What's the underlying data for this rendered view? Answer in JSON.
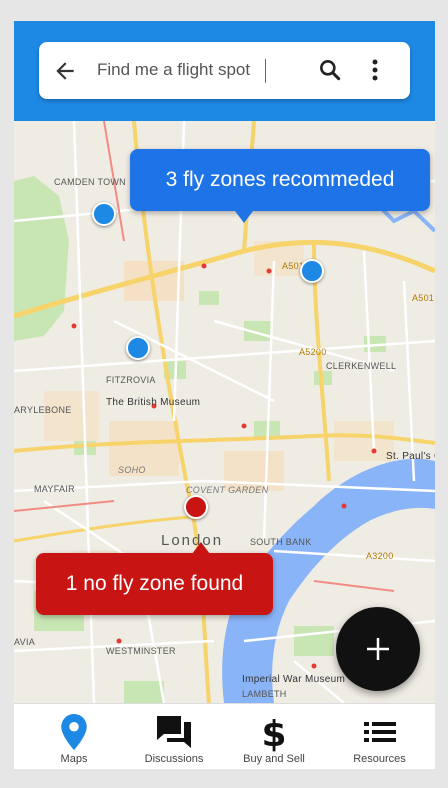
{
  "search": {
    "text": "Find me a flight spot"
  },
  "map": {
    "labels": {
      "camden_town": "CAMDEN TOWN",
      "fitzrovia": "FITZROVIA",
      "marylebone": "ARYLEBONE",
      "british_museum": "The British Museum",
      "clerkenwell": "CLERKENWELL",
      "soho": "SOHO",
      "covent_garden": "COVENT GARDEN",
      "mayfair": "MAYFAIR",
      "st_pauls": "St. Paul's Ca",
      "london": "London",
      "south_bank": "SOUTH BANK",
      "westminster": "WESTMINSTER",
      "avia": "AVIA",
      "imperial_war_museum": "Imperial War Museum",
      "lambeth": "LAMBETH",
      "a501": "A501",
      "a501_east": "A501",
      "a5200": "A5200",
      "a3200": "A3200"
    }
  },
  "bubbles": {
    "recommended": "3 fly zones recommeded",
    "no_fly": "1 no fly zone found"
  },
  "fab": {
    "icon": "plus-icon"
  },
  "nav": [
    {
      "label": "Maps",
      "icon": "location-pin-icon",
      "active": true
    },
    {
      "label": "Discussions",
      "icon": "chat-bubbles-icon",
      "active": false
    },
    {
      "label": "Buy and Sell",
      "icon": "dollar-icon",
      "active": false
    },
    {
      "label": "Resources",
      "icon": "list-icon",
      "active": false
    }
  ],
  "colors": {
    "primary_blue": "#1e88e5",
    "bubble_blue": "#1e74e6",
    "no_fly_red": "#c91414",
    "fab_black": "#111111",
    "active_nav": "#1e88e5"
  }
}
